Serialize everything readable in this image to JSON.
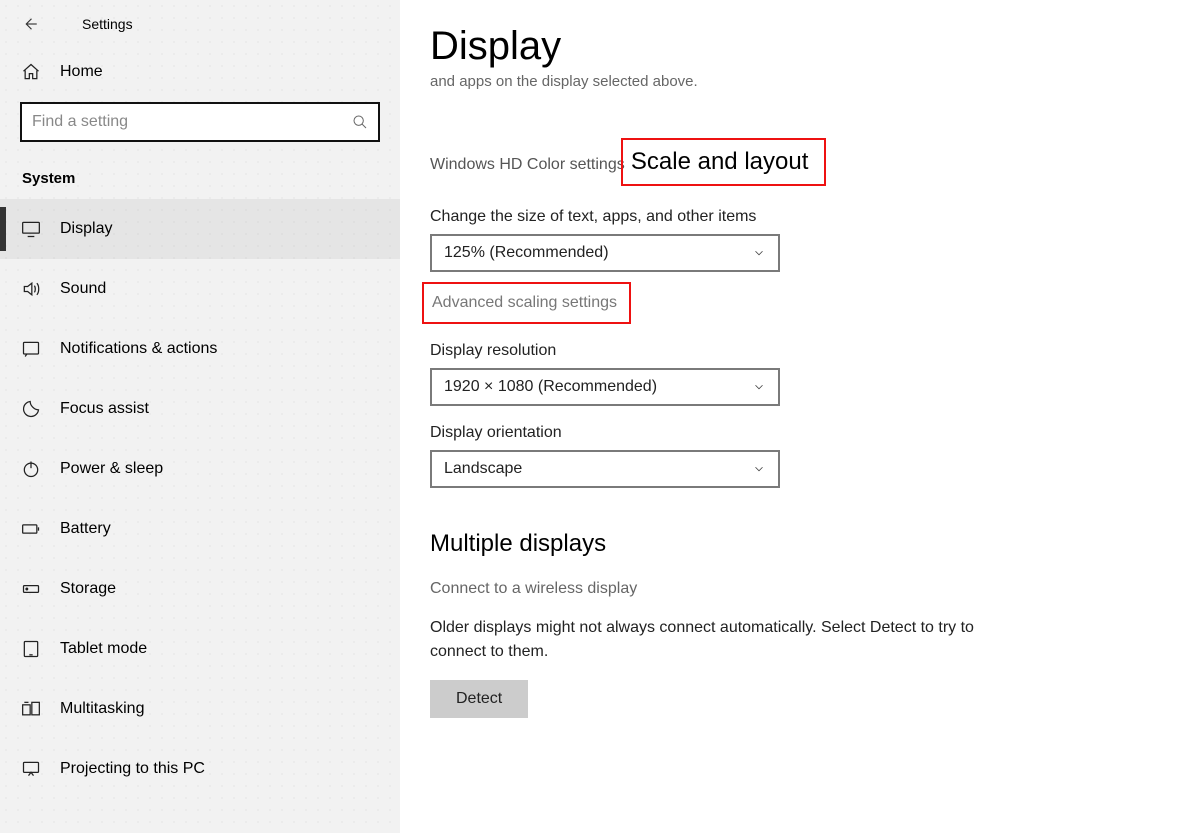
{
  "app_title": "Settings",
  "home_label": "Home",
  "search_placeholder": "Find a setting",
  "category": "System",
  "nav": [
    {
      "label": "Display"
    },
    {
      "label": "Sound"
    },
    {
      "label": "Notifications & actions"
    },
    {
      "label": "Focus assist"
    },
    {
      "label": "Power & sleep"
    },
    {
      "label": "Battery"
    },
    {
      "label": "Storage"
    },
    {
      "label": "Tablet mode"
    },
    {
      "label": "Multitasking"
    },
    {
      "label": "Projecting to this PC"
    }
  ],
  "page": {
    "title": "Display",
    "truncated": "and apps on the display selected above.",
    "hd_link": "Windows HD Color settings",
    "scale_heading": "Scale and layout",
    "size_label": "Change the size of text, apps, and other items",
    "size_value": "125% (Recommended)",
    "advanced_link": "Advanced scaling settings",
    "resolution_label": "Display resolution",
    "resolution_value": "1920 × 1080 (Recommended)",
    "orientation_label": "Display orientation",
    "orientation_value": "Landscape",
    "multi_heading": "Multiple displays",
    "wireless_link": "Connect to a wireless display",
    "older_text": "Older displays might not always connect automatically. Select Detect to try to connect to them.",
    "detect_button": "Detect"
  }
}
